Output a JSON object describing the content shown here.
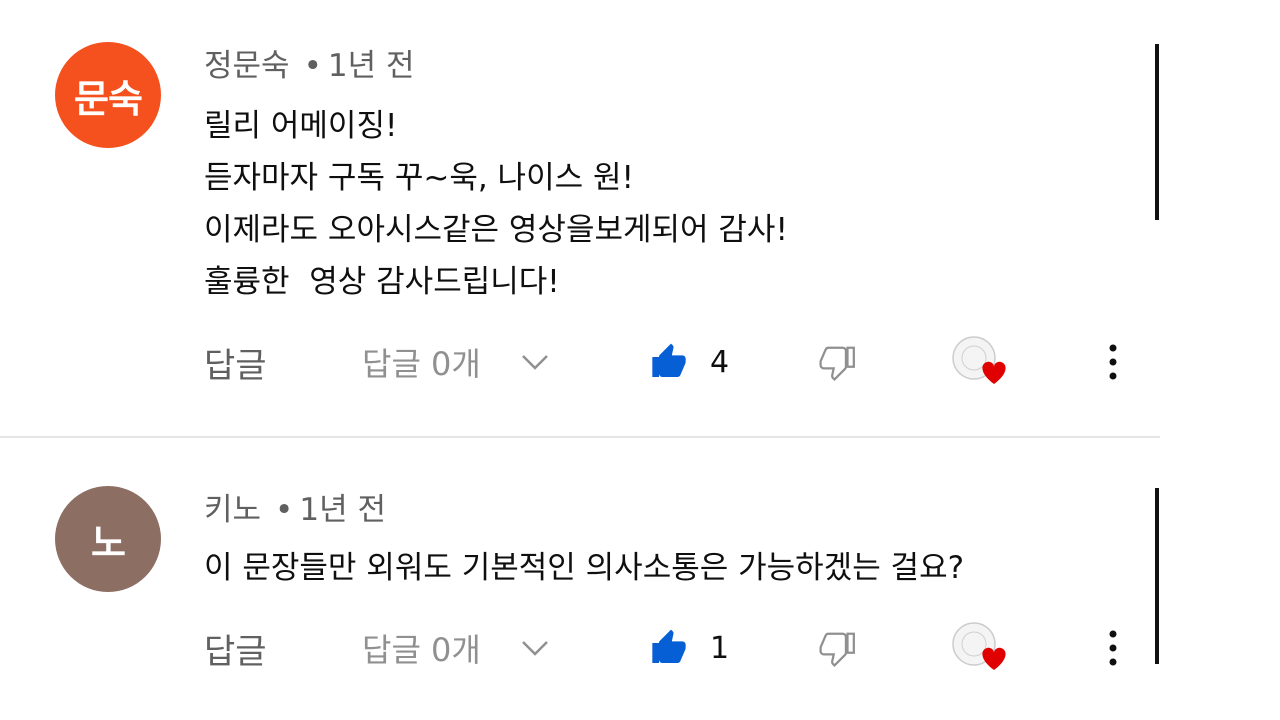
{
  "comments": [
    {
      "avatar_text": "문숙",
      "avatar_color": "#f4511e",
      "author": "정문숙",
      "time": "1년 전",
      "lines": [
        "릴리 어메이징!",
        "듣자마자 구독 꾸~욱, 나이스 원!",
        "이제라도 오아시스같은 영상을보게되어 감사!",
        "훌륭한  영상 감사드립니다!"
      ],
      "reply_label": "답글",
      "replies_label": "답글 0개",
      "like_count": "4",
      "heart_badge": "hearted-by-creator"
    },
    {
      "avatar_text": "노",
      "avatar_color": "#8d6e63",
      "author": "키노",
      "time": "1년 전",
      "lines": [
        "이 문장들만 외워도 기본적인 의사소통은 가능하겠는 걸요?"
      ],
      "reply_label": "답글",
      "replies_label": "답글 0개",
      "like_count": "1",
      "heart_badge": "hearted-by-creator"
    }
  ],
  "colors": {
    "like_blue": "#065fd4",
    "heart_red": "#e00000",
    "muted_text": "#606060"
  },
  "meta_separator": "•"
}
